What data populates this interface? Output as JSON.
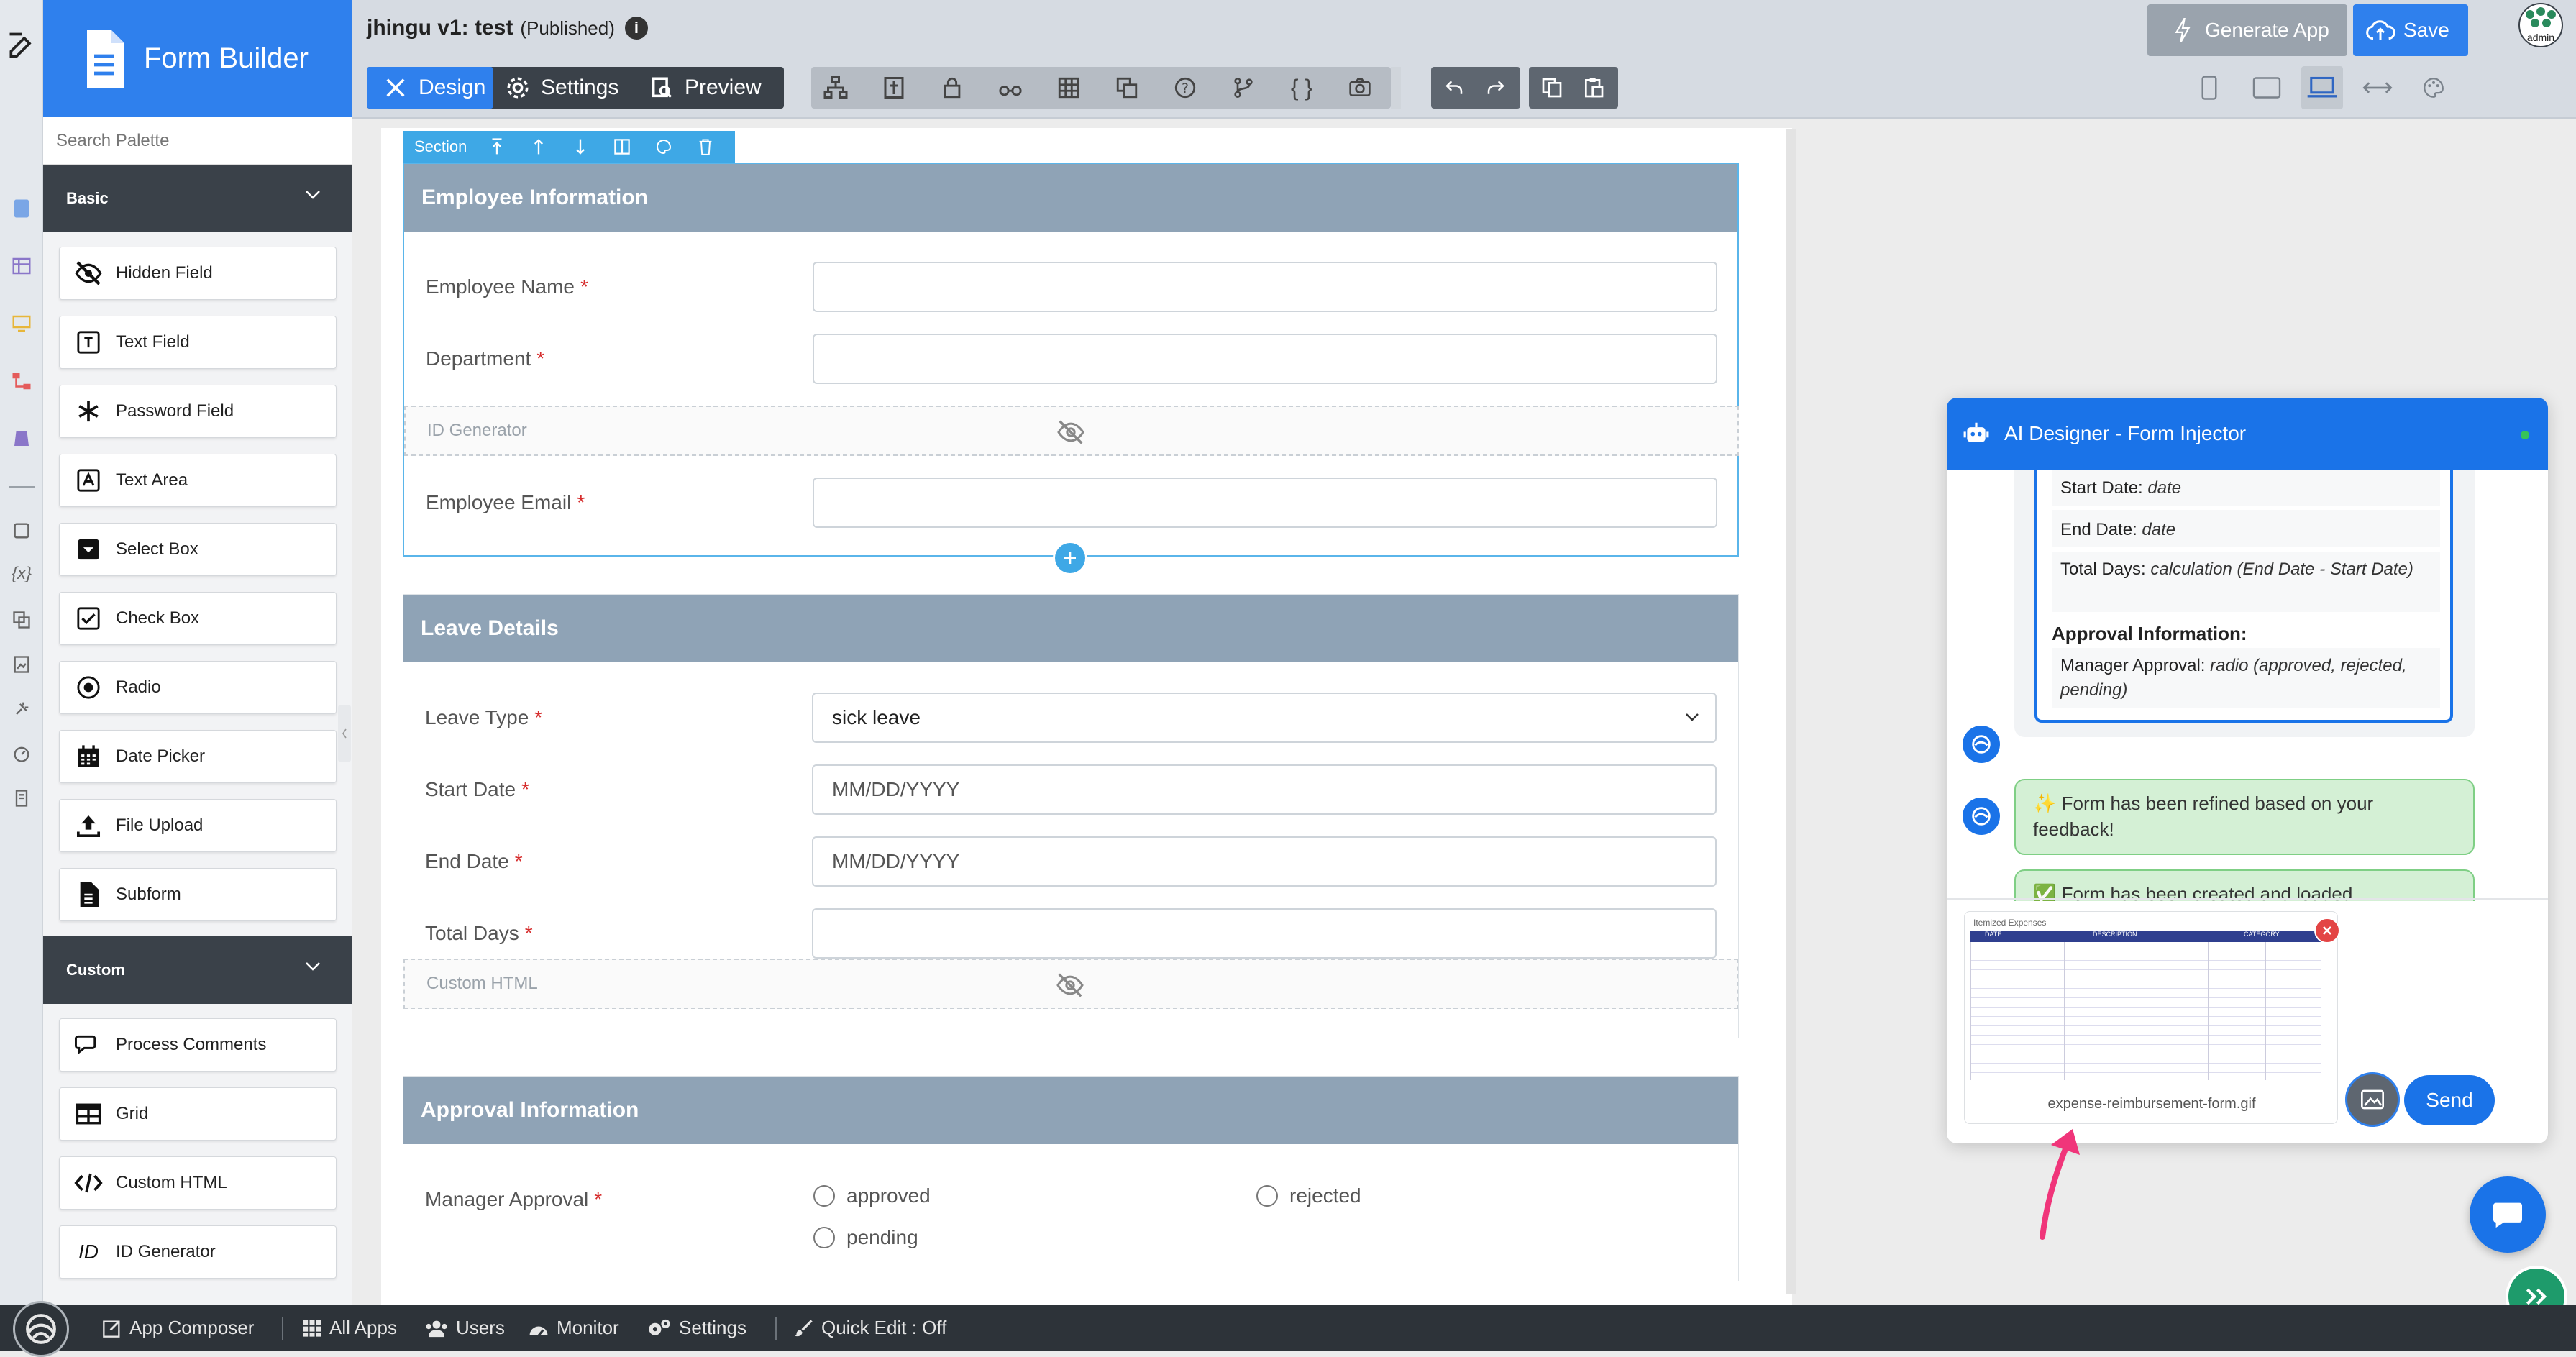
{
  "brand": {
    "title": "Form Builder"
  },
  "header": {
    "app_name": "jhingu v1: test",
    "status": "(Published)"
  },
  "tabs": [
    {
      "label": "Design"
    },
    {
      "label": "Settings"
    },
    {
      "label": "Preview"
    }
  ],
  "actions": {
    "generate_label": "Generate App",
    "save_label": "Save",
    "user_label": "admin"
  },
  "palette": {
    "search_placeholder": "Search Palette",
    "basic_label": "Basic",
    "custom_label": "Custom",
    "basic_items": [
      {
        "label": "Hidden Field",
        "icon": "eye-slash-icon"
      },
      {
        "label": "Text Field",
        "icon": "text-field-icon"
      },
      {
        "label": "Password Field",
        "icon": "asterisk-icon"
      },
      {
        "label": "Text Area",
        "icon": "text-area-icon"
      },
      {
        "label": "Select Box",
        "icon": "select-box-icon"
      },
      {
        "label": "Check Box",
        "icon": "checkbox-icon"
      },
      {
        "label": "Radio",
        "icon": "radio-icon"
      },
      {
        "label": "Date Picker",
        "icon": "calendar-icon"
      },
      {
        "label": "File Upload",
        "icon": "upload-icon"
      },
      {
        "label": "Subform",
        "icon": "subform-icon"
      }
    ],
    "custom_items": [
      {
        "label": "Process Comments",
        "icon": "comments-icon"
      },
      {
        "label": "Grid",
        "icon": "grid-icon"
      },
      {
        "label": "Custom HTML",
        "icon": "code-icon"
      },
      {
        "label": "ID Generator",
        "icon": "id-icon"
      }
    ]
  },
  "section_toolbar": {
    "label": "Section"
  },
  "form": {
    "employee": {
      "title": "Employee Information",
      "name_label": "Employee Name",
      "dept_label": "Department",
      "idgen_label": "ID Generator",
      "email_label": "Employee Email"
    },
    "leave": {
      "title": "Leave Details",
      "type_label": "Leave Type",
      "type_value": "sick leave",
      "start_label": "Start Date",
      "date_placeholder": "MM/DD/YYYY",
      "end_label": "End Date",
      "total_label": "Total Days",
      "html_label": "Custom HTML"
    },
    "approval": {
      "title": "Approval Information",
      "manager_label": "Manager Approval",
      "options": [
        "approved",
        "rejected",
        "pending"
      ]
    },
    "required_mark": "*"
  },
  "ai": {
    "title": "AI Designer - Form Injector",
    "list": [
      {
        "key": "Start Date:",
        "val": "date"
      },
      {
        "key": "End Date:",
        "val": "date"
      },
      {
        "key": "Total Days:",
        "val": "calculation (End Date - Start Date)"
      }
    ],
    "approval_heading": "Approval Information:",
    "approval_item": {
      "key": "Manager Approval:",
      "val": "radio (approved, rejected, pending)"
    },
    "refined_msg": "✨ Form has been refined based on your feedback!",
    "created_msg": "✅ Form has been created and loaded",
    "attachment_name": "expense-reimbursement-form.gif",
    "thumb_title": "Itemized Expenses",
    "thumb_cols": [
      "DATE",
      "DESCRIPTION",
      "CATEGORY"
    ],
    "send_label": "Send"
  },
  "bottom": {
    "composer": "App Composer",
    "all_apps": "All Apps",
    "users": "Users",
    "monitor": "Monitor",
    "settings": "Settings",
    "quick_edit": "Quick Edit : Off"
  },
  "colors": {
    "primary": "#2f80ed",
    "header_blue": "#1a73e8",
    "section_head": "#8fa3b6",
    "dark": "#3a4149",
    "success_bg": "#d4f0d5",
    "required": "#d62e2e"
  }
}
